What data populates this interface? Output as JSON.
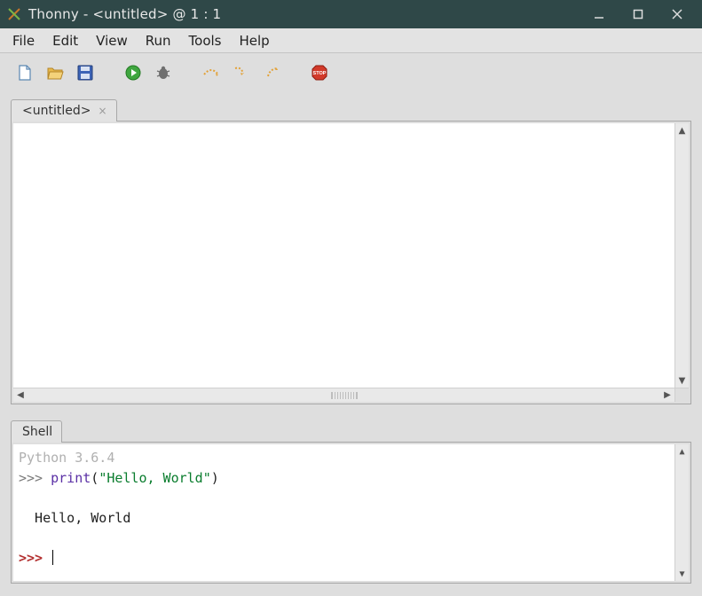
{
  "window": {
    "title": "Thonny  -  <untitled>  @  1 : 1"
  },
  "menu": {
    "items": [
      "File",
      "Edit",
      "View",
      "Run",
      "Tools",
      "Help"
    ]
  },
  "toolbar": {
    "new": "new-file-icon",
    "open": "open-file-icon",
    "save": "save-file-icon",
    "run": "run-icon",
    "debug": "debug-icon",
    "stepover": "step-over-icon",
    "stepinto": "step-into-icon",
    "stepout": "step-out-icon",
    "stop": "stop-icon"
  },
  "editor": {
    "tab_label": "<untitled>"
  },
  "shell": {
    "tab_label": "Shell",
    "banner": "Python 3.6.4",
    "prompt1": ">>> ",
    "call_name": "print",
    "call_open": "(",
    "call_str": "\"Hello, World\"",
    "call_close": ")",
    "output": "  Hello, World",
    "prompt2": ">>> "
  }
}
